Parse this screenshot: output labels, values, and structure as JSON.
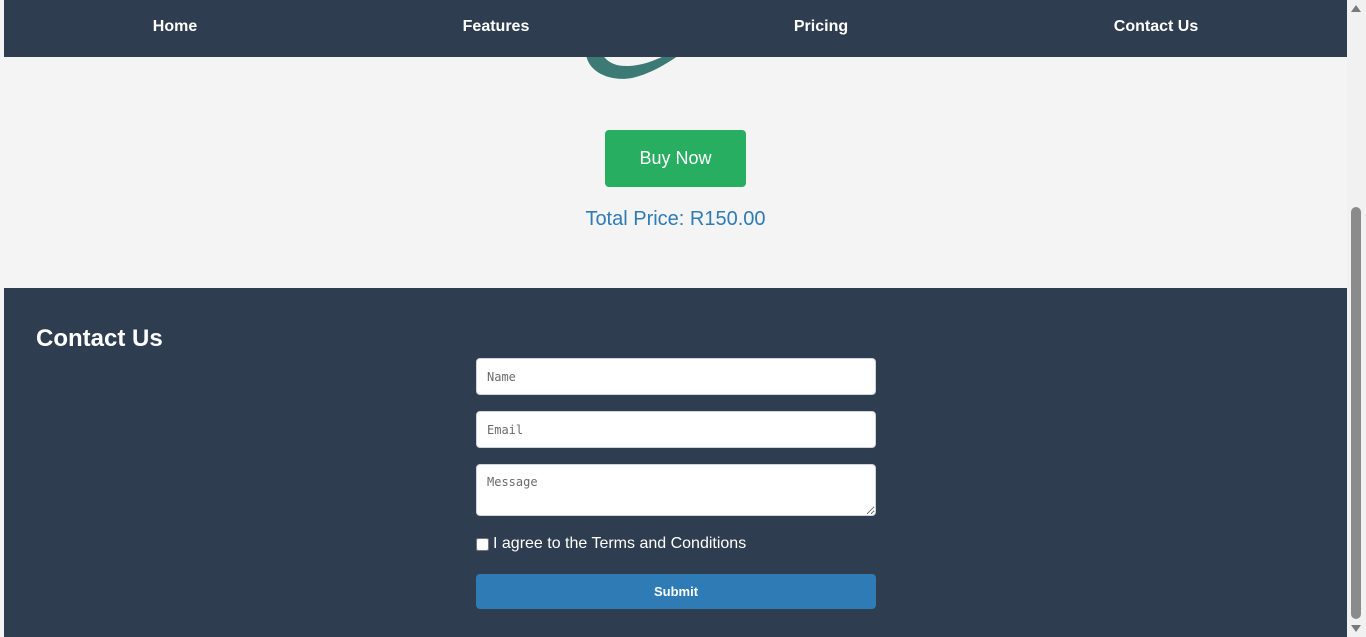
{
  "nav": {
    "items": [
      {
        "label": "Home"
      },
      {
        "label": "Features"
      },
      {
        "label": "Pricing"
      },
      {
        "label": "Contact Us"
      }
    ]
  },
  "product": {
    "buy_label": "Buy Now",
    "total_label": "Total Price: R150.00"
  },
  "contact": {
    "title": "Contact Us",
    "name_placeholder": "Name",
    "email_placeholder": "Email",
    "message_placeholder": "Message",
    "agree_label": "I agree to the Terms and Conditions",
    "submit_label": "Submit"
  },
  "colors": {
    "nav_bg": "#2e3d50",
    "accent_green": "#27ae60",
    "accent_blue": "#2e7bb6",
    "page_bg": "#f4f4f4"
  }
}
